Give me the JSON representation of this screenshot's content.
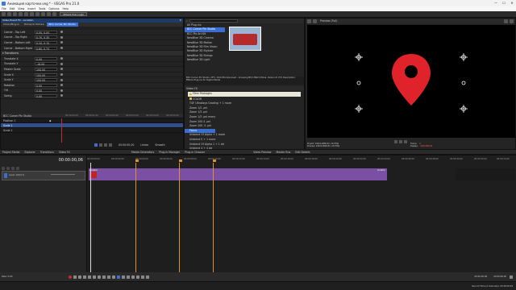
{
  "window": {
    "title": "Анимация карточки.veg * - VEGAS Pro 21.0",
    "minimize": "—",
    "maximize": "☐",
    "close": "✕"
  },
  "menu": [
    "File",
    "Edit",
    "View",
    "Insert",
    "Tools",
    "Options",
    "Help"
  ],
  "toolbar": {
    "login_label": "VEGAS Hub Login"
  },
  "event_fx": {
    "title": "Video Event FX - Location",
    "tabs": [
      "Chain/Plug-in",
      "Pickup In Picture",
      "BCC Corner Pin Studio"
    ],
    "groups": [
      {
        "label": "Corner - Top Left",
        "values": [
          "0.00, 0.00"
        ]
      },
      {
        "label": "Corner - Top Right",
        "values": [
          "0.70, 0.30"
        ]
      },
      {
        "label": "Corner - Bottom Left",
        "values": [
          "0.20, 0.70"
        ]
      },
      {
        "label": "Corner - Bottom Right",
        "values": [
          "0.80, 0.75"
        ]
      }
    ],
    "transform_label": "Transforms",
    "params": [
      {
        "label": "Translate X",
        "value": "0.00"
      },
      {
        "label": "Translate Y",
        "value": "-18.00"
      },
      {
        "label": "Master Scale",
        "value": "100.00"
      },
      {
        "label": "Scale X",
        "value": "100.00"
      },
      {
        "label": "Scale Y",
        "value": "100.00"
      },
      {
        "label": "Rotation",
        "value": "0.00"
      },
      {
        "label": "Tilt",
        "value": "0.00"
      },
      {
        "label": "Swing",
        "value": "0.00"
      }
    ],
    "keyframe_header": "BCC Corner Pin Studio",
    "keyframe_rows": [
      "Position 1",
      "Scale 1",
      "Scale 1"
    ],
    "times": [
      "00:00:00.00",
      "00:00:01.00",
      "00:00:02.00",
      "00:00:03.00",
      "00:00:04.00",
      "00:00:05.00"
    ],
    "current_time": "00:00:00,00",
    "sync_label": "Linear",
    "sync_label2": "Smooth"
  },
  "plugins": {
    "tree": [
      "All Plug-ins",
      "BCC Corner Pin Studio",
      "BCC Pix Art Kit",
      "NewBlue 3D Cinema",
      "NewBlue 3D Motion",
      "NewBlue 3D Film Vision",
      "NewBlue 3D Stylizer",
      "NewBlue 3D Strings",
      "NewBlue 3D Light"
    ],
    "search_placeholder": "",
    "description": "BCC Corner Pin Studio, OFX, 10.04 Boris/Loosed - Grouping BCC Match Move, Version 8 (73) Description: Effects Plug-ins for Digital Media",
    "section_label": "Video FX",
    "filter_label": "Filter Packages",
    "list": [
      "COLOR",
      "TGF Ultrakeys Grading + 1 more",
      "Zoom 1/2 .pnl",
      "Zoom 1/3 .pnl",
      "Zoom 1/3 .pnl every",
      "Zoom 200 4 .pnl",
      "Zoom 200 .5 .pnl",
      "Focus",
      "Unblend Of Alpha + 1 more",
      "Unblend E + 1 more",
      "Unblend Of Alpha 1 + 1 dd",
      "Unblend 4 + 4 dd"
    ],
    "tabs": [
      "Project Media",
      "Explorer",
      "Transitions",
      "Video FX",
      "Media Generators",
      "Plug-in Manager",
      "Plug-in Chooser"
    ]
  },
  "preview": {
    "toolbar_label": "Preview (Full)",
    "project_info": "Project: 1920x1080x32, 29.970p",
    "preview_info": "Preview: 1920x1080x32, 29.970p",
    "display_info": "Display: 640x360x32",
    "frame_label": "Frame:",
    "frame_value": "0",
    "display_label": "Display:",
    "display_value": "640x360x32",
    "tabs": [
      "Video Preview",
      "Master Bus",
      "Edit Details"
    ],
    "pin_color": "#e0232b"
  },
  "timeline": {
    "timecode": "00:00:00,06",
    "track_name": "Level: 100.0 %",
    "ruler": [
      "00:00:00,00",
      "00:00:02,00",
      "00:00:04,00",
      "00:00:06,00",
      "00:00:08,00",
      "00:00:10,00",
      "00:00:12,00",
      "00:00:14,00",
      "00:00:16,00",
      "00:00:18,00",
      "00:00:20,00",
      "00:00:22,00",
      "00:00:24,00",
      "00:00:26,00",
      "00:00:28,00",
      "00:00:30,00",
      "00:00:32,00",
      "00:00:34,00"
    ],
    "clip_color": "#7b4fa3",
    "clip_label_start": "Location",
    "clip_label_end": "Location"
  },
  "status": {
    "rate": "Rate: 0.00",
    "end_time": "00:00:00,06",
    "length": "00:00:06,00",
    "record_time": "Record Time (2 channels): 25:36:59:29"
  }
}
